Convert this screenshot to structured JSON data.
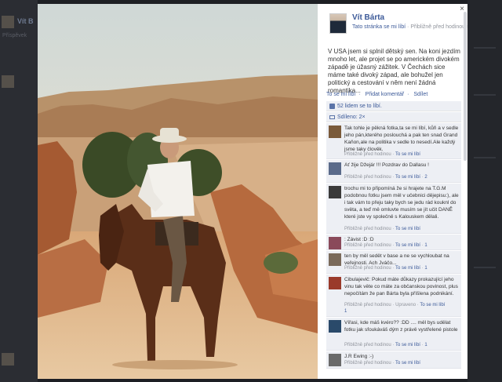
{
  "post": {
    "author": "Vít Bárta",
    "page_like": "Tato stránka se mi líbí",
    "time": "Přibližně před hodinou",
    "text": "V USA jsem si splnil dětský sen. Na koni jezdím mnoho let, ale projet se po americkém divokém západě je úžasný zážitek. V Čechách sice máme také divoký západ, ale bohužel jen politický a cestování v něm není žádná romantika...",
    "action_like": "To se mi líbí",
    "action_comment": "Přidat komentář",
    "action_share": "Sdílet",
    "likes_count": "52 lidem se to líbí.",
    "shares_count": "Sdíleno: 2×",
    "close_symbol": "×",
    "separator": "·"
  },
  "comments": [
    {
      "text": "Tak tohle je pěkná fotka,ta se mi líbí, kůň a v sedle jeho pán,kterého poslouchá a pak ten snad Grand Kaňon,ale na politika v sedle to nesedí.Ale každý jsme taky člověk.",
      "time": "Přibližně před hodinou",
      "like": "To se mi líbí",
      "count": ""
    },
    {
      "text": "Ať žije Džejár !!! Pozdrav do Dallasu !",
      "time": "Přibližně před hodinou",
      "like": "To se mi líbí",
      "count": "2"
    },
    {
      "text": "trochu mi to připomíná že si hrajete na T.G.M podobnou fotku jsem měl v učebnici dějepisu:), ale i tak vám to přeju taky bych se jedu rád kouknl do světa, a teď mě omluvte musím se jít učit DANĚ které jste vy společně s Kalouskem dělali.",
      "time": "Přibližně před hodinou",
      "like": "To se mi líbí",
      "count": ""
    },
    {
      "text": ": Závist :D :D",
      "time": "Přibližně před hodinou",
      "like": "To se mi líbí",
      "count": "1"
    },
    {
      "text": "ten by měl sedět v base a ne se vychloubat na veřejnosti. Ach Jváčo...",
      "time": "Přibližně před hodinou",
      "like": "To se mi líbí",
      "count": "1"
    },
    {
      "text": "Cibulajevič: Pokud máte důkazy prokazující jeho vinu tak věte co máte za občanskou povinost, plus nepočítám že pan Bárta byla příšlena podnikání.",
      "time": "Přibližně před hodinou",
      "like": "To se mi líbí",
      "count": "1",
      "extra": "Upraveno"
    },
    {
      "text": "Vířasi, kde máš kvéro?? :DD .... měl bys udělat fotku jak sfoukáváš dým z právě vystřelené pistole",
      "time": "Přibližně před hodinou",
      "like": "To se mi líbí",
      "count": "1"
    },
    {
      "text": "J.R Ewing :-)",
      "time": "Přibližně před hodinou",
      "like": "To se mi líbí",
      "count": ""
    }
  ],
  "background": {
    "top_name": "Vít B",
    "item1": "Příspěvek",
    "colors": {
      "link": "#3b5998",
      "meta": "#90949c",
      "comment_bg": "#edeff4"
    }
  },
  "icons": [
    "close-icon",
    "like-thumb-icon",
    "share-icon",
    "globe-icon"
  ]
}
